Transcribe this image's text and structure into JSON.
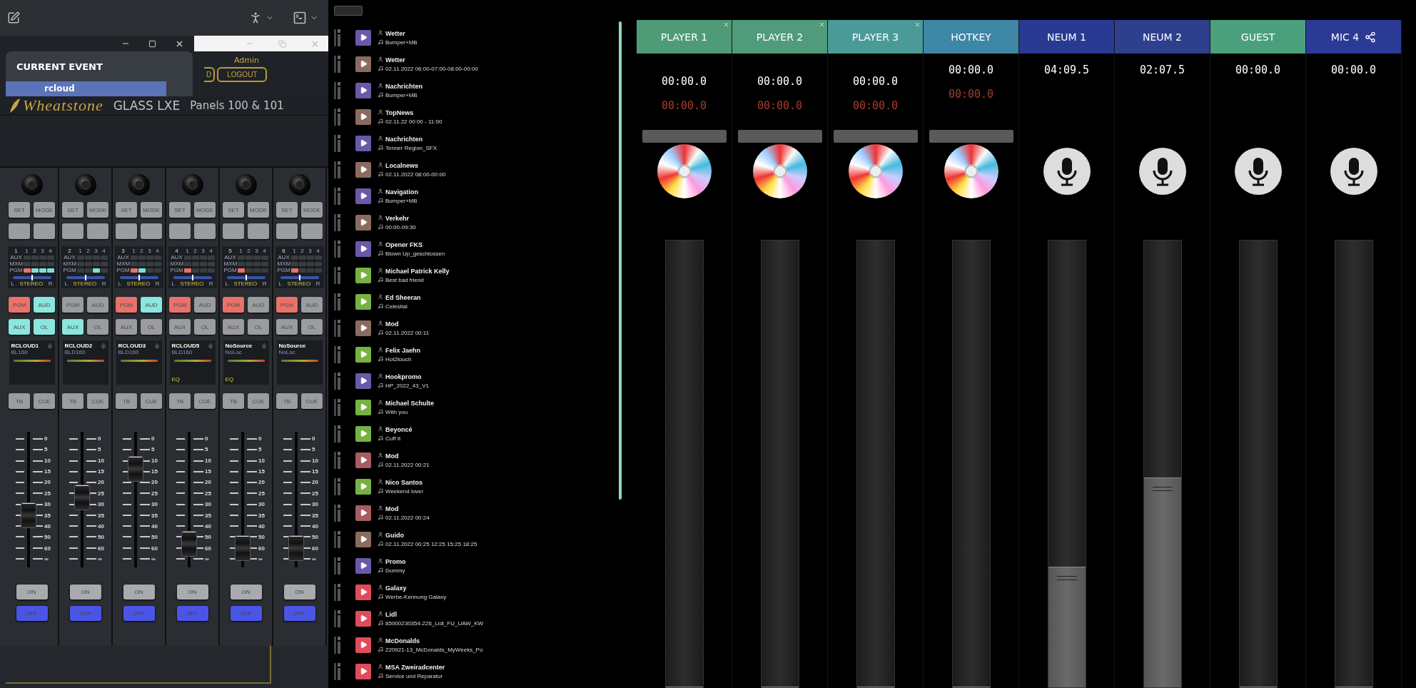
{
  "event": {
    "heading": "CURRENT EVENT",
    "items": [
      {
        "label": "rcloud",
        "selected": true
      }
    ]
  },
  "user": {
    "name": "Admin",
    "buttons": [
      "D",
      "LOGOUT"
    ]
  },
  "brand": {
    "logo": "Wheatstone",
    "product": "GLASS LXE",
    "panels": "Panels 100 & 101"
  },
  "channels": [
    {
      "number": "1",
      "setup": [
        "SET",
        "MODE"
      ],
      "bus_cols": [
        "1",
        "2",
        "3",
        "4"
      ],
      "bus_rows": [
        {
          "label": "AUX",
          "cells": [
            {
              "on": false
            },
            {
              "on": false
            },
            {
              "on": false
            },
            {
              "on": false
            }
          ]
        },
        {
          "label": "MXM",
          "cells": [
            {
              "on": false
            },
            {
              "on": false
            },
            {
              "on": false
            },
            {
              "on": false
            }
          ]
        },
        {
          "label": "PGM",
          "cells": [
            {
              "on": true,
              "color": "#e8726a"
            },
            {
              "on": true,
              "color": "#7fe0d8"
            },
            {
              "on": true,
              "color": "#7fe0d8"
            },
            {
              "on": true,
              "color": "#7fe0d8"
            }
          ]
        }
      ],
      "pan": {
        "level": 0.5
      },
      "pan_labels": [
        "L",
        "STEREO",
        "R"
      ],
      "routing": [
        {
          "label": "PGM",
          "on": true,
          "color": "#e8726a"
        },
        {
          "label": "AUD",
          "on": true,
          "color": "#8ae6de"
        },
        {
          "label": "AUX",
          "on": true,
          "color": "#8ae6de"
        },
        {
          "label": "OL",
          "on": true,
          "color": "#8ae6de"
        }
      ],
      "name": "RCLOUD1",
      "mic": true,
      "location": "BL160",
      "talk": [
        "TB",
        "CUE"
      ],
      "scale": [
        "0",
        "5",
        "10",
        "15",
        "20",
        "25",
        "30",
        "35",
        "40",
        "50",
        "60",
        "∞"
      ],
      "level": 0.36,
      "switches": [
        {
          "label": "ON",
          "on": false
        },
        {
          "label": "OFF",
          "on": true,
          "color": "#4a55e6"
        }
      ]
    },
    {
      "number": "2",
      "setup": [
        "SET",
        "MODE"
      ],
      "bus_cols": [
        "1",
        "2",
        "3",
        "4"
      ],
      "bus_rows": [
        {
          "label": "AUX",
          "cells": [
            {
              "on": false
            },
            {
              "on": false
            },
            {
              "on": false
            },
            {
              "on": false
            }
          ]
        },
        {
          "label": "MXM",
          "cells": [
            {
              "on": false
            },
            {
              "on": false
            },
            {
              "on": false
            },
            {
              "on": false
            }
          ]
        },
        {
          "label": "PGM",
          "cells": [
            {
              "on": false
            },
            {
              "on": false
            },
            {
              "on": true,
              "color": "#7fe0d8"
            },
            {
              "on": false
            }
          ]
        }
      ],
      "pan": {
        "level": 0.5
      },
      "pan_labels": [
        "L",
        "STEREO",
        "R"
      ],
      "routing": [
        {
          "label": "PGM",
          "on": false
        },
        {
          "label": "AUD",
          "on": false
        },
        {
          "label": "AUX",
          "on": true,
          "color": "#8ae6de"
        },
        {
          "label": "OL",
          "on": false
        }
      ],
      "name": "RCLOUD2",
      "mic": true,
      "location": "BLD160",
      "talk": [
        "TB",
        "CUE"
      ],
      "scale": [
        "0",
        "5",
        "10",
        "15",
        "20",
        "25",
        "30",
        "35",
        "40",
        "50",
        "60",
        "∞"
      ],
      "level": 0.52,
      "switches": [
        {
          "label": "ON",
          "on": false
        },
        {
          "label": "OFF",
          "on": true,
          "color": "#4a55e6"
        }
      ]
    },
    {
      "number": "3",
      "setup": [
        "SET",
        "MODE"
      ],
      "bus_cols": [
        "1",
        "2",
        "3",
        "4"
      ],
      "bus_rows": [
        {
          "label": "AUX",
          "cells": [
            {
              "on": false
            },
            {
              "on": false
            },
            {
              "on": false
            },
            {
              "on": false
            }
          ]
        },
        {
          "label": "MXM",
          "cells": [
            {
              "on": false
            },
            {
              "on": false
            },
            {
              "on": false
            },
            {
              "on": false
            }
          ]
        },
        {
          "label": "PGM",
          "cells": [
            {
              "on": true,
              "color": "#e8726a"
            },
            {
              "on": true,
              "color": "#7fe0d8"
            },
            {
              "on": false
            },
            {
              "on": false
            }
          ]
        }
      ],
      "pan": {
        "level": 0.5
      },
      "pan_labels": [
        "L",
        "STEREO",
        "R"
      ],
      "routing": [
        {
          "label": "PGM",
          "on": true,
          "color": "#e8726a"
        },
        {
          "label": "AUD",
          "on": true,
          "color": "#8ae6de"
        },
        {
          "label": "AUX",
          "on": false
        },
        {
          "label": "OL",
          "on": false
        }
      ],
      "name": "RCLOUD3",
      "mic": true,
      "location": "BLD160",
      "talk": [
        "TB",
        "CUE"
      ],
      "scale": [
        "0",
        "5",
        "10",
        "15",
        "20",
        "25",
        "30",
        "35",
        "40",
        "50",
        "60",
        "∞"
      ],
      "level": 0.78,
      "switches": [
        {
          "label": "ON",
          "on": false
        },
        {
          "label": "OFF",
          "on": true,
          "color": "#4a55e6"
        }
      ]
    },
    {
      "number": "4",
      "setup": [
        "SET",
        "MODE"
      ],
      "bus_cols": [
        "1",
        "2",
        "3",
        "4"
      ],
      "bus_rows": [
        {
          "label": "AUX",
          "cells": [
            {
              "on": false
            },
            {
              "on": false
            },
            {
              "on": false
            },
            {
              "on": false
            }
          ]
        },
        {
          "label": "MXM",
          "cells": [
            {
              "on": false
            },
            {
              "on": false
            },
            {
              "on": false
            },
            {
              "on": false
            }
          ]
        },
        {
          "label": "PGM",
          "cells": [
            {
              "on": true,
              "color": "#e8726a"
            },
            {
              "on": false
            },
            {
              "on": false
            },
            {
              "on": false
            }
          ]
        }
      ],
      "pan": {
        "level": 0.5
      },
      "pan_labels": [
        "L",
        "STEREO",
        "R"
      ],
      "routing": [
        {
          "label": "PGM",
          "on": true,
          "color": "#e8726a"
        },
        {
          "label": "AUD",
          "on": false
        },
        {
          "label": "AUX",
          "on": false
        },
        {
          "label": "OL",
          "on": false
        }
      ],
      "name": "RCLOUD5",
      "mic": true,
      "location": "BLD160",
      "eq": "EQ",
      "talk": [
        "TB",
        "CUE"
      ],
      "scale": [
        "0",
        "5",
        "10",
        "15",
        "20",
        "25",
        "30",
        "35",
        "40",
        "50",
        "60",
        "∞"
      ],
      "level": 0.1,
      "switches": [
        {
          "label": "ON",
          "on": false
        },
        {
          "label": "OFF",
          "on": true,
          "color": "#4a55e6"
        }
      ]
    },
    {
      "number": "5",
      "setup": [
        "SET",
        "MODE"
      ],
      "bus_cols": [
        "1",
        "2",
        "3",
        "4"
      ],
      "bus_rows": [
        {
          "label": "AUX",
          "cells": [
            {
              "on": false
            },
            {
              "on": false
            },
            {
              "on": false
            },
            {
              "on": false
            }
          ]
        },
        {
          "label": "MXM",
          "cells": [
            {
              "on": false
            },
            {
              "on": false
            },
            {
              "on": false
            },
            {
              "on": false
            }
          ]
        },
        {
          "label": "PGM",
          "cells": [
            {
              "on": true,
              "color": "#e8726a"
            },
            {
              "on": false
            },
            {
              "on": false
            },
            {
              "on": false
            }
          ]
        }
      ],
      "pan": {
        "level": 0.5
      },
      "pan_labels": [
        "L",
        "STEREO",
        "R"
      ],
      "routing": [
        {
          "label": "PGM",
          "on": true,
          "color": "#e8726a"
        },
        {
          "label": "AUD",
          "on": false
        },
        {
          "label": "AUX",
          "on": false
        },
        {
          "label": "OL",
          "on": false
        }
      ],
      "name": "NoSource",
      "mic": true,
      "location": "NoLoc",
      "eq": "EQ",
      "talk": [
        "TB",
        "CUE"
      ],
      "scale": [
        "0",
        "5",
        "10",
        "15",
        "20",
        "25",
        "30",
        "35",
        "40",
        "50",
        "60",
        "∞"
      ],
      "level": 0.06,
      "switches": [
        {
          "label": "ON",
          "on": false
        },
        {
          "label": "OFF",
          "on": true,
          "color": "#4a55e6"
        }
      ]
    },
    {
      "number": "6",
      "setup": [
        "SET",
        "MODE"
      ],
      "bus_cols": [
        "1",
        "2",
        "3",
        "4"
      ],
      "bus_rows": [
        {
          "label": "AUX",
          "cells": [
            {
              "on": false
            },
            {
              "on": false
            },
            {
              "on": false
            },
            {
              "on": false
            }
          ]
        },
        {
          "label": "MXM",
          "cells": [
            {
              "on": false
            },
            {
              "on": false
            },
            {
              "on": false
            },
            {
              "on": false
            }
          ]
        },
        {
          "label": "PGM",
          "cells": [
            {
              "on": true,
              "color": "#e8726a"
            },
            {
              "on": false
            },
            {
              "on": false
            },
            {
              "on": false
            }
          ]
        }
      ],
      "pan": {
        "level": 0.5
      },
      "pan_labels": [
        "L",
        "STEREO",
        "R"
      ],
      "routing": [
        {
          "label": "PGM",
          "on": true,
          "color": "#e8726a"
        },
        {
          "label": "AUD",
          "on": false
        },
        {
          "label": "AUX",
          "on": false
        },
        {
          "label": "OL",
          "on": false
        }
      ],
      "name": "NoSource",
      "mic": false,
      "location": "NoLoc",
      "talk": [
        "TB",
        "CUE"
      ],
      "scale": [
        "0",
        "5",
        "10",
        "15",
        "20",
        "25",
        "30",
        "35",
        "40",
        "50",
        "60",
        "∞"
      ],
      "level": 0.06,
      "switches": [
        {
          "label": "ON",
          "on": false
        },
        {
          "label": "OFF",
          "on": true,
          "color": "#4a55e6"
        }
      ]
    }
  ],
  "playlist": {
    "items": [
      {
        "title": "Wetter",
        "subtitle": "Bumper+MB",
        "color": "#6a58a8"
      },
      {
        "title": "Wetter",
        "subtitle": "02.11.2022 06:00-07:00-08:00-00:00",
        "color": "#8a6b60"
      },
      {
        "title": "Nachrichten",
        "subtitle": "Bumper+MB",
        "color": "#6a58a8"
      },
      {
        "title": "TopNews",
        "subtitle": "02.11.22 00:00 - 11:00",
        "color": "#8a6b60"
      },
      {
        "title": "Nachrichten",
        "subtitle": "Tenner Region_SFX",
        "color": "#6a58a8"
      },
      {
        "title": "Localnews",
        "subtitle": "02.11.2022 08:00-00:00",
        "color": "#8a6b60"
      },
      {
        "title": "Navigation",
        "subtitle": "Bumper+MB",
        "color": "#6a58a8"
      },
      {
        "title": "Verkehr",
        "subtitle": "00:00-09:30",
        "color": "#8a6b60"
      },
      {
        "title": "Opener FKS",
        "subtitle": "Blown Up_geschlossen",
        "color": "#6a58a8"
      },
      {
        "title": "Michael Patrick Kelly",
        "subtitle": "Best bad friend",
        "color": "#78b143"
      },
      {
        "title": "Ed Sheeran",
        "subtitle": "Celestial",
        "color": "#78b143"
      },
      {
        "title": "Mod",
        "subtitle": "02.11.2022 00:11",
        "color": "#8a6b60"
      },
      {
        "title": "Felix Jaehn",
        "subtitle": "Hot2touch",
        "color": "#78b143"
      },
      {
        "title": "Hookpromo",
        "subtitle": "HP_2022_43_V1",
        "color": "#6a58a8"
      },
      {
        "title": "Michael Schulte",
        "subtitle": "With you",
        "color": "#78b143"
      },
      {
        "title": "Beyoncé",
        "subtitle": "Cuff It",
        "color": "#78b143"
      },
      {
        "title": "Mod",
        "subtitle": "02.11.2022 00:21",
        "color": "#a65c60"
      },
      {
        "title": "Nico Santos",
        "subtitle": "Weekend lover",
        "color": "#78b143"
      },
      {
        "title": "Mod",
        "subtitle": "02.11.2022 00:24",
        "color": "#a65c60"
      },
      {
        "title": "Guido",
        "subtitle": "02.11.2022 00:25 12:25 15:25 18:25",
        "color": "#8a6b60"
      },
      {
        "title": "Promo",
        "subtitle": "Dummy",
        "color": "#6a58a8"
      },
      {
        "title": "Galaxy",
        "subtitle": "Werbe-Kennung Galaxy",
        "color": "#e04c5c"
      },
      {
        "title": "Lidl",
        "subtitle": "85000230354-226_Lidl_FU_UAW_KW",
        "color": "#e04c5c"
      },
      {
        "title": "McDonalds",
        "subtitle": "220921-13_McDonalds_MyWeeks_Po",
        "color": "#e04c5c"
      },
      {
        "title": "MSA Zweiradcenter",
        "subtitle": "Service und Reparatur",
        "color": "#e04c5c"
      }
    ]
  },
  "players": [
    {
      "label": "PLAYER 1",
      "color": "#4f9b78",
      "closable": true,
      "share": false,
      "kind": "player",
      "time": "00:00.0",
      "remaining": "00:00.0",
      "bar": true,
      "level": 0
    },
    {
      "label": "PLAYER 2",
      "color": "#4f9b7c",
      "closable": true,
      "share": false,
      "kind": "player",
      "time": "00:00.0",
      "remaining": "00:00.0",
      "bar": true,
      "level": 0
    },
    {
      "label": "PLAYER 3",
      "color": "#4a9a98",
      "closable": true,
      "share": false,
      "kind": "player",
      "time": "00:00.0",
      "remaining": "00:00.0",
      "bar": true,
      "level": 0
    },
    {
      "label": "HOTKEY",
      "color": "#3d86a6",
      "closable": false,
      "share": false,
      "kind": "hotkey",
      "time": "00:00.0",
      "remaining": "00:00.0",
      "bar": true,
      "level": 0
    },
    {
      "label": "NEUM 1",
      "color": "#283a92",
      "closable": false,
      "share": false,
      "kind": "mic",
      "time": "04:09.5",
      "bar": false,
      "level": 0.27
    },
    {
      "label": "NEUM 2",
      "color": "#2e3f8e",
      "closable": false,
      "share": false,
      "kind": "mic",
      "time": "02:07.5",
      "bar": false,
      "level": 0.47
    },
    {
      "label": "GUEST",
      "color": "#4aa07c",
      "closable": false,
      "share": false,
      "kind": "mic",
      "time": "00:00.0",
      "bar": false,
      "level": 0
    },
    {
      "label": "MIC 4",
      "color": "#2b3a94",
      "closable": false,
      "share": true,
      "kind": "mic",
      "time": "00:00.0",
      "bar": false,
      "level": 0
    }
  ]
}
